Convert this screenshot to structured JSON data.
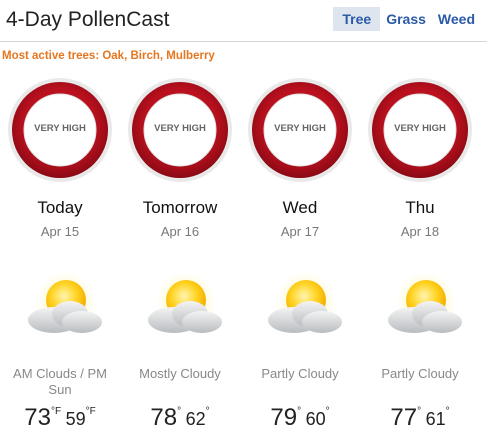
{
  "header": {
    "title": "4-Day PollenCast",
    "tabs": [
      {
        "label": "Tree",
        "active": true
      },
      {
        "label": "Grass",
        "active": false
      },
      {
        "label": "Weed",
        "active": false
      }
    ]
  },
  "subtitle": "Most active trees: Oak, Birch, Mulberry",
  "colors": {
    "ring_red": "#b8101e",
    "accent_orange": "#e6761f",
    "tab_blue": "#2a5aa8"
  },
  "days": [
    {
      "pollen_level": "VERY HIGH",
      "name": "Today",
      "date": "Apr 15",
      "icon": "partly-sunny-icon",
      "condition": "AM Clouds / PM Sun",
      "high": "73",
      "high_unit": "°F",
      "low": "59",
      "low_unit": "°F"
    },
    {
      "pollen_level": "VERY HIGH",
      "name": "Tomorrow",
      "date": "Apr 16",
      "icon": "partly-sunny-icon",
      "condition": "Mostly Cloudy",
      "high": "78",
      "high_unit": "°",
      "low": "62",
      "low_unit": "°"
    },
    {
      "pollen_level": "VERY HIGH",
      "name": "Wed",
      "date": "Apr 17",
      "icon": "partly-sunny-icon",
      "condition": "Partly Cloudy",
      "high": "79",
      "high_unit": "°",
      "low": "60",
      "low_unit": "°"
    },
    {
      "pollen_level": "VERY HIGH",
      "name": "Thu",
      "date": "Apr 18",
      "icon": "partly-sunny-icon",
      "condition": "Partly Cloudy",
      "high": "77",
      "high_unit": "°",
      "low": "61",
      "low_unit": "°"
    }
  ]
}
